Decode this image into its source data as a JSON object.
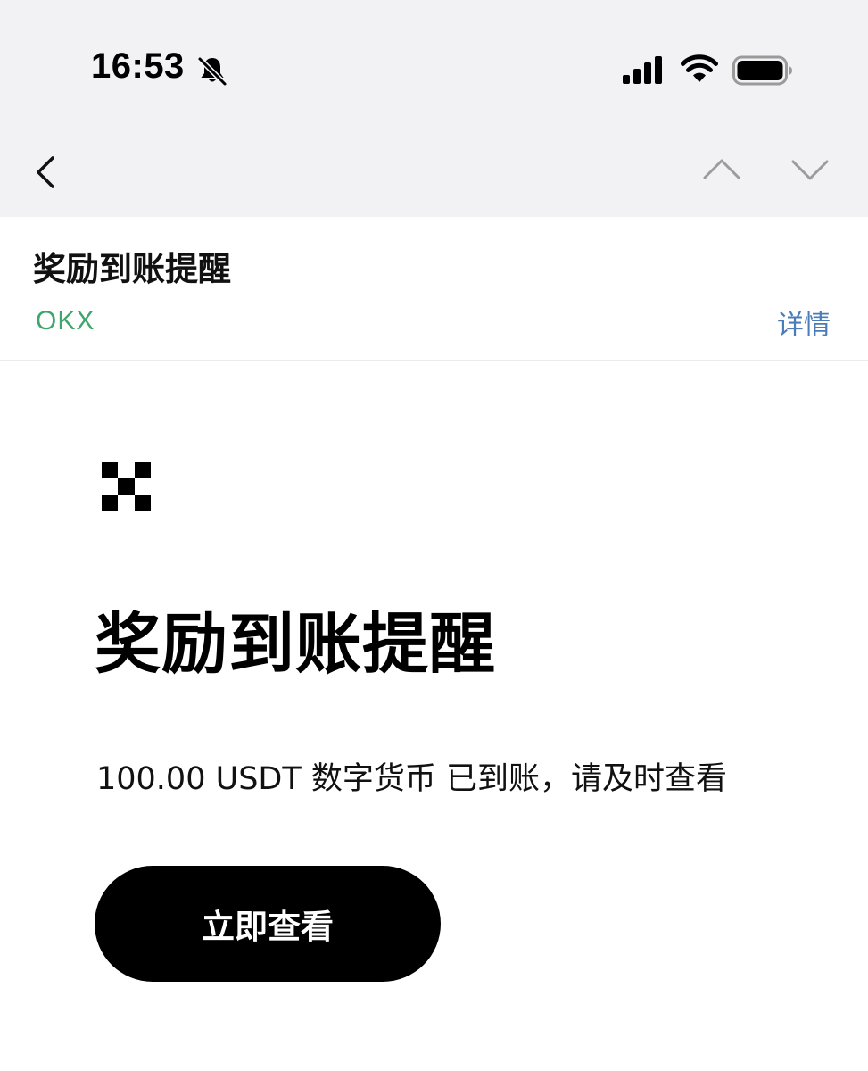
{
  "status_bar": {
    "time": "16:53",
    "icons": [
      "bell-off-icon",
      "signal-icon",
      "wifi-icon",
      "battery-icon"
    ]
  },
  "nav": {
    "icons": [
      "chevron-left-icon",
      "chevron-up-icon",
      "chevron-down-icon"
    ]
  },
  "message": {
    "title": "奖励到账提醒",
    "sender": "OKX",
    "detail_label": "详情"
  },
  "content": {
    "logo": "okx-logo",
    "hero_title": "奖励到账提醒",
    "body": "100.00 USDT 数字货币 已到账，请及时查看",
    "button_label": "立即查看"
  },
  "colors": {
    "top_background": "#f2f2f4",
    "sender_green": "#3fa66b",
    "link_blue": "#4a7cb8",
    "button_black": "#000000"
  }
}
